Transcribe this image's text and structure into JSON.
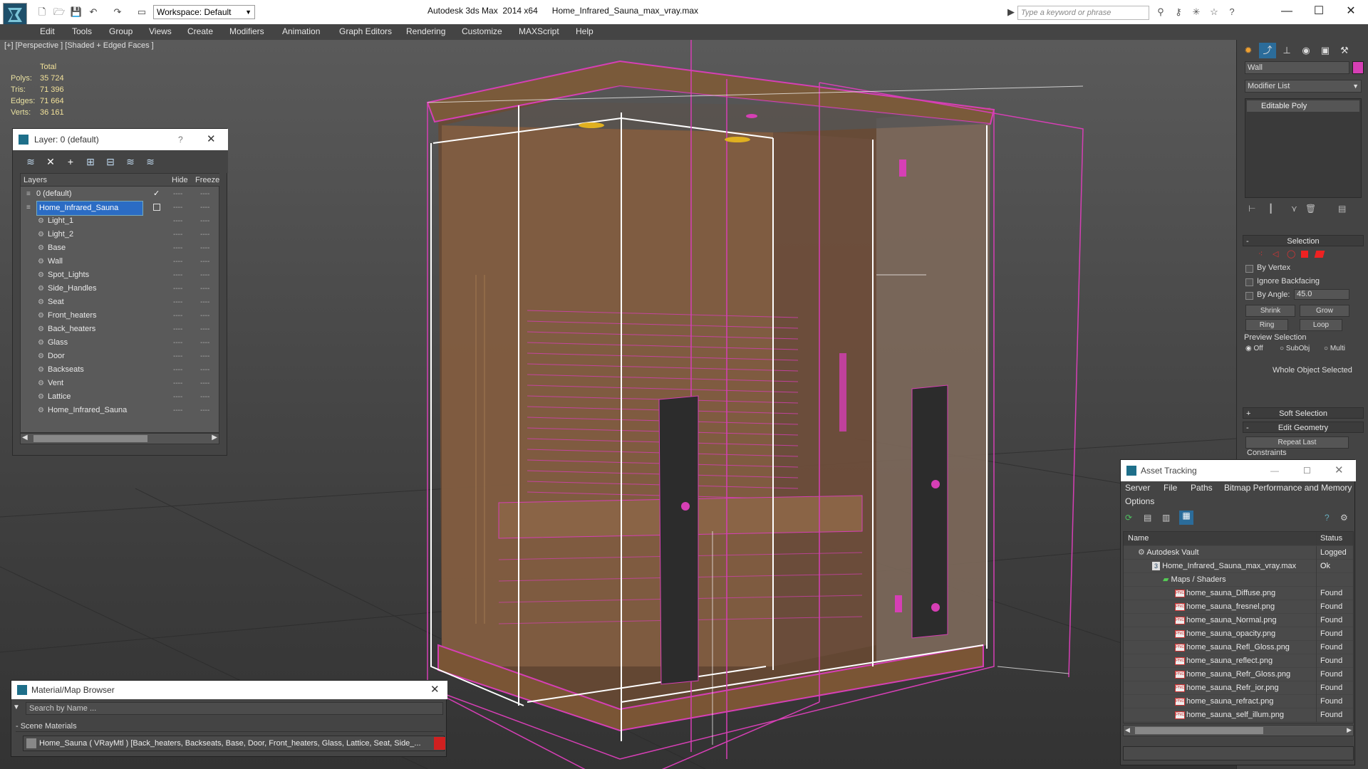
{
  "app": {
    "title": "Autodesk 3ds Max  2014 x64",
    "filename": "Home_Infrared_Sauna_max_vray.max",
    "workspace": "Workspace: Default",
    "search_placeholder": "Type a keyword or phrase"
  },
  "menu": [
    "Edit",
    "Tools",
    "Group",
    "Views",
    "Create",
    "Modifiers",
    "Animation",
    "Graph Editors",
    "Rendering",
    "Customize",
    "MAXScript",
    "Help"
  ],
  "viewport": {
    "label": "[+] [Perspective ] [Shaded + Edged Faces ]",
    "stats": {
      "header": "Total",
      "polys_label": "Polys:",
      "polys": "35 724",
      "tris_label": "Tris:",
      "tris": "71 396",
      "edges_label": "Edges:",
      "edges": "71 664",
      "verts_label": "Verts:",
      "verts": "36 161"
    }
  },
  "layer_dialog": {
    "title": "Layer: 0 (default)",
    "help": "?",
    "columns": {
      "layers": "Layers",
      "hide": "Hide",
      "freeze": "Freeze"
    },
    "rows": [
      "0 (default)",
      "Home_Infrared_Sauna",
      "Light_1",
      "Light_2",
      "Base",
      "Wall",
      "Spot_Lights",
      "Side_Handles",
      "Seat",
      "Front_heaters",
      "Back_heaters",
      "Glass",
      "Door",
      "Backseats",
      "Vent",
      "Lattice",
      "Home_Infrared_Sauna"
    ],
    "dash": "----"
  },
  "command_panel": {
    "object_name": "Wall",
    "object_color": "#d63fb5",
    "modifier_list": "Modifier List",
    "stack_item": "Editable Poly",
    "selection": {
      "title": "Selection",
      "by_vertex": "By Vertex",
      "ignore_backfacing": "Ignore Backfacing",
      "by_angle": "By Angle:",
      "angle_value": "45.0",
      "shrink": "Shrink",
      "grow": "Grow",
      "ring": "Ring",
      "loop": "Loop",
      "preview_label": "Preview Selection",
      "off": "Off",
      "subobj": "SubObj",
      "multi": "Multi",
      "status": "Whole Object Selected"
    },
    "soft_selection": "Soft Selection",
    "edit_geometry": "Edit Geometry",
    "repeat_last": "Repeat Last",
    "constraints": "Constraints"
  },
  "asset_tracking": {
    "title": "Asset Tracking",
    "menu": [
      "Server",
      "File",
      "Paths",
      "Bitmap Performance and Memory",
      "Options"
    ],
    "columns": {
      "name": "Name",
      "status": "Status"
    },
    "rows": [
      {
        "name": "Autodesk Vault",
        "status": "Logged O"
      },
      {
        "name": "Home_Infrared_Sauna_max_vray.max",
        "status": "Ok"
      },
      {
        "name": "Maps / Shaders",
        "status": ""
      },
      {
        "name": "home_sauna_Diffuse.png",
        "status": "Found"
      },
      {
        "name": "home_sauna_fresnel.png",
        "status": "Found"
      },
      {
        "name": "home_sauna_Normal.png",
        "status": "Found"
      },
      {
        "name": "home_sauna_opacity.png",
        "status": "Found"
      },
      {
        "name": "home_sauna_Refl_Gloss.png",
        "status": "Found"
      },
      {
        "name": "home_sauna_reflect.png",
        "status": "Found"
      },
      {
        "name": "home_sauna_Refr_Gloss.png",
        "status": "Found"
      },
      {
        "name": "home_sauna_Refr_ior.png",
        "status": "Found"
      },
      {
        "name": "home_sauna_refract.png",
        "status": "Found"
      },
      {
        "name": "home_sauna_self_illum.png",
        "status": "Found"
      }
    ],
    "png_badge": "PNG"
  },
  "material_browser": {
    "title": "Material/Map Browser",
    "search_placeholder": "Search by Name ...",
    "group": "- Scene Materials",
    "entry": "Home_Sauna  ( VRayMtl )  [Back_heaters, Backseats, Base, Door, Front_heaters, Glass, Lattice, Seat, Side_..."
  }
}
